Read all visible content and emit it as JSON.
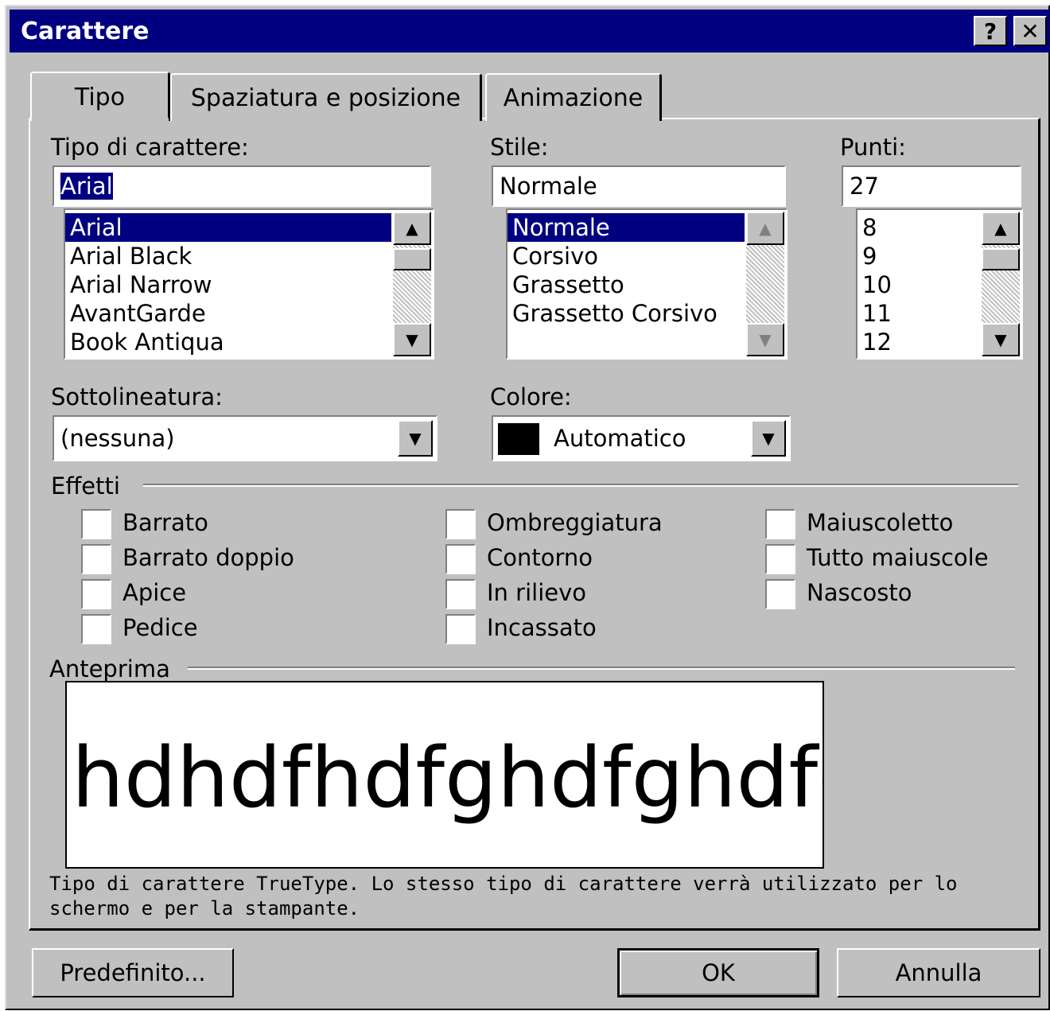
{
  "window": {
    "title": "Carattere",
    "help_label": "?",
    "close_label": "✕"
  },
  "tabs": [
    {
      "label": "Tipo",
      "active": true
    },
    {
      "label": "Spaziatura e posizione",
      "active": false
    },
    {
      "label": "Animazione",
      "active": false
    }
  ],
  "font": {
    "label": "Tipo di carattere:",
    "value": "Arial",
    "options": [
      "Arial",
      "Arial Black",
      "Arial Narrow",
      "AvantGarde",
      "Book Antiqua"
    ]
  },
  "style": {
    "label": "Stile:",
    "value": "Normale",
    "options": [
      "Normale",
      "Corsivo",
      "Grassetto",
      "Grassetto Corsivo"
    ]
  },
  "size": {
    "label": "Punti:",
    "value": "27",
    "options": [
      "8",
      "9",
      "10",
      "11",
      "12"
    ]
  },
  "underline": {
    "label": "Sottolineatura:",
    "value": "(nessuna)"
  },
  "color": {
    "label": "Colore:",
    "value": "Automatico",
    "swatch": "#000000"
  },
  "effects": {
    "label": "Effetti",
    "items": [
      {
        "label": "Barrato",
        "checked": false
      },
      {
        "label": "Barrato doppio",
        "checked": false
      },
      {
        "label": "Apice",
        "checked": false
      },
      {
        "label": "Pedice",
        "checked": false
      },
      {
        "label": "Ombreggiatura",
        "checked": false
      },
      {
        "label": "Contorno",
        "checked": false
      },
      {
        "label": "In rilievo",
        "checked": false
      },
      {
        "label": "Incassato",
        "checked": false
      },
      {
        "label": "Maiuscoletto",
        "checked": false
      },
      {
        "label": "Tutto maiuscole",
        "checked": false
      },
      {
        "label": "Nascosto",
        "checked": false
      }
    ]
  },
  "preview": {
    "label": "Anteprima",
    "text": "hdhdfhdfghdfghdfg",
    "note": "Tipo di carattere TrueType. Lo stesso tipo di carattere verrà utilizzato per lo schermo e per la stampante."
  },
  "buttons": {
    "default": "Predefinito...",
    "ok": "OK",
    "cancel": "Annulla"
  },
  "colors": {
    "titlebar": "#000080",
    "face": "#c0c0c0",
    "selection": "#000080"
  }
}
